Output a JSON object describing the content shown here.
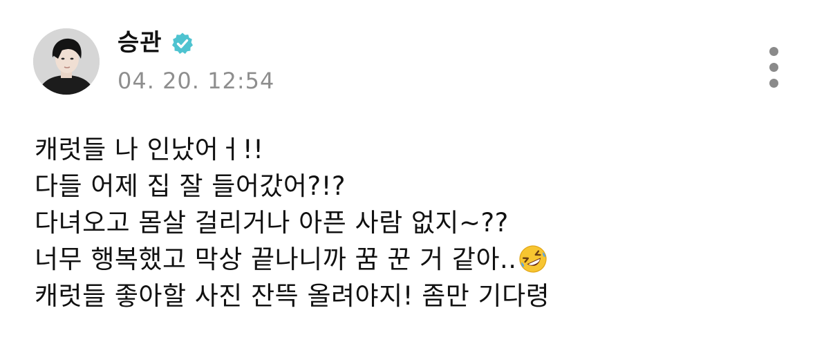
{
  "author": {
    "name": "승관",
    "verified": true,
    "avatar_icon": "avatar-photo",
    "badge_color": "#4ec3d0"
  },
  "post": {
    "timestamp": "04. 20. 12:54",
    "lines": [
      "캐럿들 나 인났어ㅓ!!",
      "다들 어제 집 잘 들어갔어?!?",
      "다녀오고 몸살 걸리거나 아픈 사람 없지~??",
      "너무 행복했고 막상 끝나니까 꿈 꾼 거 같아..",
      "캐럿들 좋아할 사진 잔뜩 올려야지! 좀만 기다령"
    ],
    "line4_emoji": "rolling-on-floor-laughing-emoji"
  },
  "menu": {
    "icon": "more-vertical-icon",
    "color": "#8a8a8a"
  }
}
